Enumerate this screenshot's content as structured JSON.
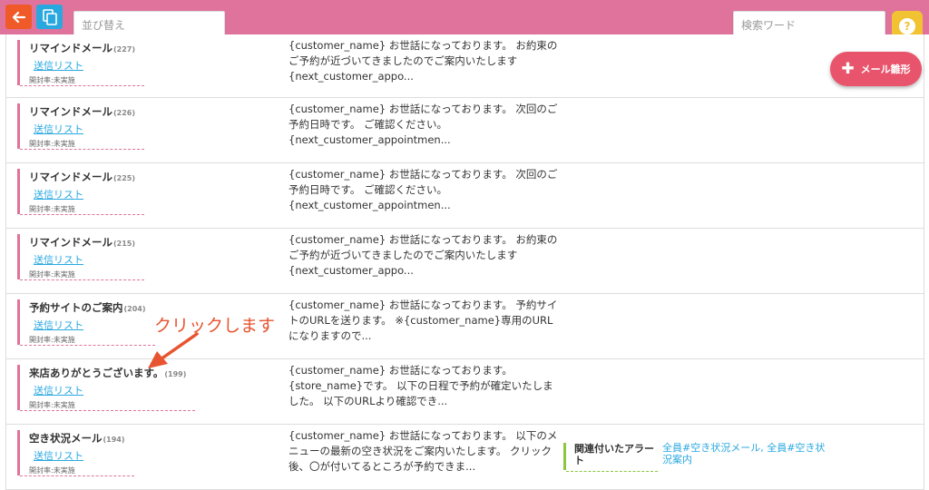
{
  "header": {
    "back_icon": "arrow-left-icon",
    "copy_icon": "copy-icon",
    "sort_placeholder": "並び替え",
    "search_placeholder": "検索ワード",
    "help_label": "?",
    "colors": {
      "bar": "#e0739b",
      "back": "#f05a28",
      "copy": "#29a8e0",
      "help": "#f1c232"
    }
  },
  "fab": {
    "icon": "plus-icon",
    "label": "メール雛形",
    "color": "#e8546b"
  },
  "rows": [
    {
      "title": "リマインドメール",
      "count": "(227)",
      "send_list": "送信リスト",
      "open_rate": "開封率:未実施",
      "preview": [
        "{customer_name} お世話になっております。 お約束の",
        "ご予約が近づいてきましたのでご案内いたします",
        "{next_customer_appo..."
      ]
    },
    {
      "title": "リマインドメール",
      "count": "(226)",
      "send_list": "送信リスト",
      "open_rate": "開封率:未実施",
      "preview": [
        "{customer_name} お世話になっております。 次回のご",
        "予約日時です。 ご確認ください。",
        "{next_customer_appointmen..."
      ]
    },
    {
      "title": "リマインドメール",
      "count": "(225)",
      "send_list": "送信リスト",
      "open_rate": "開封率:未実施",
      "preview": [
        "{customer_name} お世話になっております。 次回のご",
        "予約日時です。 ご確認ください。",
        "{next_customer_appointmen..."
      ]
    },
    {
      "title": "リマインドメール",
      "count": "(215)",
      "send_list": "送信リスト",
      "open_rate": "開封率:未実施",
      "preview": [
        "{customer_name} お世話になっております。 お約束の",
        "ご予約が近づいてきましたのでご案内いたします",
        "{next_customer_appo..."
      ]
    },
    {
      "title": "予約サイトのご案内",
      "count": "(204)",
      "send_list": "送信リスト",
      "open_rate": "開封率:未実施",
      "preview": [
        "{customer_name} お世話になっております。 予約サイ",
        "トのURLを送ります。 ※{customer_name}専用のURL",
        "になりますので..."
      ]
    },
    {
      "title": "来店ありがとうございます。",
      "count": "(199)",
      "send_list": "送信リスト",
      "open_rate": "開封率:未実施",
      "preview": [
        "{customer_name} お世話になっております。",
        "{store_name}です。 以下の日程で予約が確定いたしま",
        "した。 以下のURLより確認でき..."
      ]
    },
    {
      "title": "空き状況メール",
      "count": "(194)",
      "send_list": "送信リスト",
      "open_rate": "開封率:未実施",
      "preview": [
        "{customer_name} お世話になっております。 以下のメ",
        "ニューの最新の空き状況をご案内いたします。 クリック",
        "後、〇が付いてるところが予約できま..."
      ],
      "alert_label": "関連付いたアラート",
      "alert_links": "全員#空き状況メール, 全員#空き状況案内"
    }
  ],
  "annotation": {
    "text": "クリックします",
    "color": "#e8542f"
  }
}
